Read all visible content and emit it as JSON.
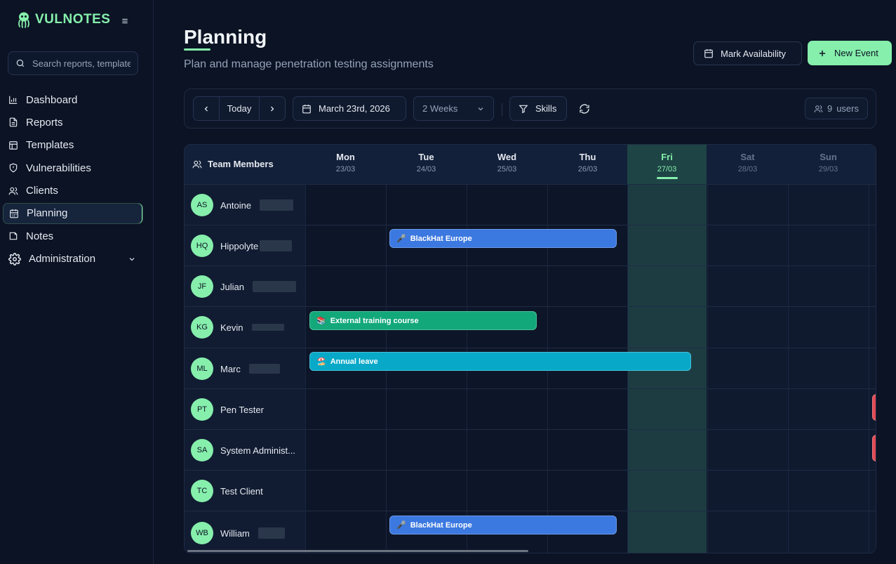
{
  "app": {
    "name": "VULNOTES"
  },
  "search": {
    "placeholder": "Search reports, templates..."
  },
  "sidebar": {
    "items": [
      {
        "label": "Dashboard",
        "icon": "chart-bar-icon"
      },
      {
        "label": "Reports",
        "icon": "file-text-icon"
      },
      {
        "label": "Templates",
        "icon": "layout-icon"
      },
      {
        "label": "Vulnerabilities",
        "icon": "shield-icon"
      },
      {
        "label": "Clients",
        "icon": "users-icon"
      },
      {
        "label": "Planning",
        "icon": "calendar-icon",
        "active": true
      },
      {
        "label": "Notes",
        "icon": "note-icon"
      },
      {
        "label": "Administration",
        "icon": "gear-icon",
        "expandable": true
      }
    ]
  },
  "header": {
    "title": "Planning",
    "subtitle": "Plan and manage penetration testing assignments",
    "mark_label": "Mark Availability",
    "new_label": "New Event"
  },
  "toolbar": {
    "today_label": "Today",
    "date_label": "March 23rd, 2026",
    "range_label": "2 Weeks",
    "skills_label": "Skills",
    "users_count": "9",
    "users_label": "users"
  },
  "grid": {
    "members_title": "Team Members",
    "days": [
      {
        "name": "Mon",
        "date": "23/03"
      },
      {
        "name": "Tue",
        "date": "24/03"
      },
      {
        "name": "Wed",
        "date": "25/03"
      },
      {
        "name": "Thu",
        "date": "26/03"
      },
      {
        "name": "Fri",
        "date": "27/03",
        "today": true
      },
      {
        "name": "Sat",
        "date": "28/03",
        "weekend": true
      },
      {
        "name": "Sun",
        "date": "29/03",
        "weekend": true
      }
    ],
    "members": [
      {
        "initials": "AS",
        "name": "Antoine"
      },
      {
        "initials": "HQ",
        "name": "Hippolyte"
      },
      {
        "initials": "JF",
        "name": "Julian"
      },
      {
        "initials": "KG",
        "name": "Kevin"
      },
      {
        "initials": "ML",
        "name": "Marc"
      },
      {
        "initials": "PT",
        "name": "Pen Tester"
      },
      {
        "initials": "SA",
        "name": "System Administ..."
      },
      {
        "initials": "TC",
        "name": "Test Client"
      },
      {
        "initials": "WB",
        "name": "William"
      }
    ],
    "events": [
      {
        "label": "BlackHat Europe",
        "emoji": "🎤",
        "color": "blue"
      },
      {
        "label": "External training course",
        "emoji": "📚",
        "color": "green"
      },
      {
        "label": "Annual leave",
        "emoji": "🏖️",
        "color": "cyan"
      },
      {
        "label": "BlackHat Europe",
        "emoji": "🎤",
        "color": "blue"
      }
    ]
  },
  "colors": {
    "accent": "#86efac",
    "background": "#0b1324",
    "today_column": "#1d3c42"
  }
}
